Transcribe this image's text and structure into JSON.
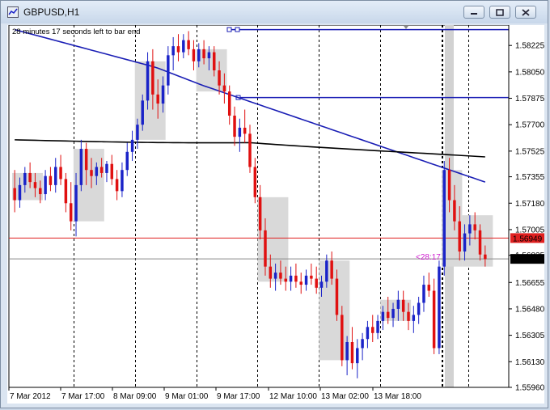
{
  "window": {
    "title": "GBPUSD,H1",
    "minimize_icon": "minimize-icon",
    "restore_icon": "restore-icon",
    "close_icon": "close-icon"
  },
  "status": {
    "countdown": "28 minutes 17 seconds left to bar end",
    "timer_label": "<28:17"
  },
  "colors": {
    "bull": "#1a23c8",
    "bear": "#e01010",
    "ma_fast": "#1a1eb5",
    "ma_slow": "#000000",
    "bid_line": "#e02020",
    "current_price_bg": "#000000",
    "bid_price_bg": "#e02020",
    "timer": "#d020d0"
  },
  "chart_data": {
    "type": "candlestick",
    "symbol": "GBPUSD",
    "timeframe": "H1",
    "y_ticks": [
      "1.58225",
      "1.58050",
      "1.57875",
      "1.57700",
      "1.57525",
      "1.57355",
      "1.57180",
      "1.57005",
      "1.56835",
      "1.56655",
      "1.56480",
      "1.56305",
      "1.56130",
      "1.55960"
    ],
    "ylim": [
      1.5596,
      1.5836
    ],
    "x_ticks": [
      "7 Mar 2012",
      "7 Mar 17:00",
      "8 Mar 09:00",
      "9 Mar 01:00",
      "9 Mar 17:00",
      "12 Mar 10:00",
      "13 Mar 02:00",
      "13 Mar 18:00"
    ],
    "bid_price": "1.56949",
    "current_price": "1.56811",
    "hlines": [
      1.5833,
      1.5788
    ],
    "candles": [
      [
        1.5728,
        1.574,
        1.5712,
        1.572
      ],
      [
        1.572,
        1.5735,
        1.5715,
        1.573
      ],
      [
        1.573,
        1.5742,
        1.5725,
        1.5738
      ],
      [
        1.5738,
        1.5745,
        1.5728,
        1.5732
      ],
      [
        1.5732,
        1.5738,
        1.5722,
        1.5728
      ],
      [
        1.5728,
        1.5733,
        1.5718,
        1.5724
      ],
      [
        1.5724,
        1.574,
        1.572,
        1.5736
      ],
      [
        1.5736,
        1.5742,
        1.5726,
        1.573
      ],
      [
        1.573,
        1.5748,
        1.5725,
        1.5742
      ],
      [
        1.5742,
        1.575,
        1.573,
        1.5734
      ],
      [
        1.5734,
        1.5738,
        1.5712,
        1.5718
      ],
      [
        1.5718,
        1.5732,
        1.57,
        1.5706
      ],
      [
        1.5706,
        1.5738,
        1.5696,
        1.573
      ],
      [
        1.573,
        1.576,
        1.5726,
        1.5754
      ],
      [
        1.5754,
        1.5758,
        1.573,
        1.574
      ],
      [
        1.574,
        1.5748,
        1.5728,
        1.5736
      ],
      [
        1.5736,
        1.5745,
        1.573,
        1.5742
      ],
      [
        1.5742,
        1.5748,
        1.5735,
        1.5738
      ],
      [
        1.5738,
        1.5746,
        1.5732,
        1.5744
      ],
      [
        1.5744,
        1.575,
        1.573,
        1.5734
      ],
      [
        1.5734,
        1.574,
        1.572,
        1.5726
      ],
      [
        1.5726,
        1.5745,
        1.5722,
        1.574
      ],
      [
        1.574,
        1.5758,
        1.5736,
        1.5752
      ],
      [
        1.5752,
        1.5766,
        1.5746,
        1.576
      ],
      [
        1.576,
        1.5774,
        1.5754,
        1.577
      ],
      [
        1.577,
        1.579,
        1.5766,
        1.5786
      ],
      [
        1.5786,
        1.5818,
        1.578,
        1.5812
      ],
      [
        1.5812,
        1.582,
        1.578,
        1.579
      ],
      [
        1.579,
        1.58,
        1.5774,
        1.5784
      ],
      [
        1.5784,
        1.5802,
        1.5778,
        1.5796
      ],
      [
        1.5796,
        1.5822,
        1.579,
        1.5816
      ],
      [
        1.5816,
        1.5828,
        1.5806,
        1.5822
      ],
      [
        1.5822,
        1.583,
        1.5812,
        1.5818
      ],
      [
        1.5818,
        1.583,
        1.5814,
        1.5826
      ],
      [
        1.5826,
        1.5832,
        1.5816,
        1.582
      ],
      [
        1.582,
        1.5826,
        1.5806,
        1.5812
      ],
      [
        1.5812,
        1.5824,
        1.5808,
        1.582
      ],
      [
        1.582,
        1.5826,
        1.581,
        1.5814
      ],
      [
        1.5814,
        1.5822,
        1.5806,
        1.5818
      ],
      [
        1.5818,
        1.5822,
        1.5802,
        1.5806
      ],
      [
        1.5806,
        1.5812,
        1.579,
        1.5796
      ],
      [
        1.5796,
        1.5804,
        1.5784,
        1.5792
      ],
      [
        1.5792,
        1.5796,
        1.577,
        1.5776
      ],
      [
        1.5776,
        1.5782,
        1.5756,
        1.5762
      ],
      [
        1.5762,
        1.5774,
        1.5752,
        1.5768
      ],
      [
        1.5768,
        1.578,
        1.5758,
        1.5764
      ],
      [
        1.5764,
        1.577,
        1.5738,
        1.5742
      ],
      [
        1.5742,
        1.5748,
        1.5718,
        1.5722
      ],
      [
        1.5722,
        1.573,
        1.5694,
        1.57
      ],
      [
        1.57,
        1.5708,
        1.567,
        1.5676
      ],
      [
        1.5676,
        1.5684,
        1.5662,
        1.5668
      ],
      [
        1.5668,
        1.5678,
        1.566,
        1.5672
      ],
      [
        1.5672,
        1.568,
        1.5664,
        1.5668
      ],
      [
        1.5668,
        1.5676,
        1.566,
        1.5666
      ],
      [
        1.5666,
        1.5676,
        1.566,
        1.567
      ],
      [
        1.567,
        1.5678,
        1.5662,
        1.5666
      ],
      [
        1.5666,
        1.5672,
        1.5658,
        1.5664
      ],
      [
        1.5664,
        1.5674,
        1.566,
        1.567
      ],
      [
        1.567,
        1.5678,
        1.5664,
        1.5668
      ],
      [
        1.5668,
        1.5676,
        1.5658,
        1.5662
      ],
      [
        1.5662,
        1.567,
        1.5656,
        1.5666
      ],
      [
        1.5666,
        1.5684,
        1.5662,
        1.568
      ],
      [
        1.568,
        1.5686,
        1.5664,
        1.5668
      ],
      [
        1.5668,
        1.5674,
        1.564,
        1.5644
      ],
      [
        1.5644,
        1.565,
        1.561,
        1.5614
      ],
      [
        1.5614,
        1.563,
        1.5604,
        1.5626
      ],
      [
        1.5626,
        1.5636,
        1.5608,
        1.5612
      ],
      [
        1.5612,
        1.5628,
        1.5602,
        1.5622
      ],
      [
        1.5622,
        1.5632,
        1.5614,
        1.5628
      ],
      [
        1.5628,
        1.564,
        1.5622,
        1.5636
      ],
      [
        1.5636,
        1.5644,
        1.5626,
        1.5632
      ],
      [
        1.5632,
        1.5644,
        1.5628,
        1.564
      ],
      [
        1.564,
        1.565,
        1.5634,
        1.5646
      ],
      [
        1.5646,
        1.5656,
        1.5638,
        1.5642
      ],
      [
        1.5642,
        1.5652,
        1.5636,
        1.5648
      ],
      [
        1.5648,
        1.566,
        1.564,
        1.5654
      ],
      [
        1.5654,
        1.566,
        1.564,
        1.5646
      ],
      [
        1.5646,
        1.5652,
        1.5634,
        1.564
      ],
      [
        1.564,
        1.565,
        1.5632,
        1.5644
      ],
      [
        1.5644,
        1.5656,
        1.5638,
        1.5652
      ],
      [
        1.5652,
        1.567,
        1.5646,
        1.5664
      ],
      [
        1.5664,
        1.5672,
        1.5656,
        1.566
      ],
      [
        1.566,
        1.5668,
        1.5618,
        1.5622
      ],
      [
        1.5622,
        1.568,
        1.5618,
        1.5676
      ],
      [
        1.5676,
        1.5746,
        1.567,
        1.574
      ],
      [
        1.574,
        1.5748,
        1.5712,
        1.572
      ],
      [
        1.572,
        1.573,
        1.57,
        1.5706
      ],
      [
        1.5706,
        1.5716,
        1.568,
        1.5686
      ],
      [
        1.5686,
        1.5704,
        1.568,
        1.5698
      ],
      [
        1.5698,
        1.571,
        1.569,
        1.5704
      ],
      [
        1.5704,
        1.5712,
        1.5694,
        1.57
      ],
      [
        1.57,
        1.5704,
        1.568,
        1.5684
      ],
      [
        1.5684,
        1.569,
        1.5676,
        1.5681
      ]
    ]
  }
}
